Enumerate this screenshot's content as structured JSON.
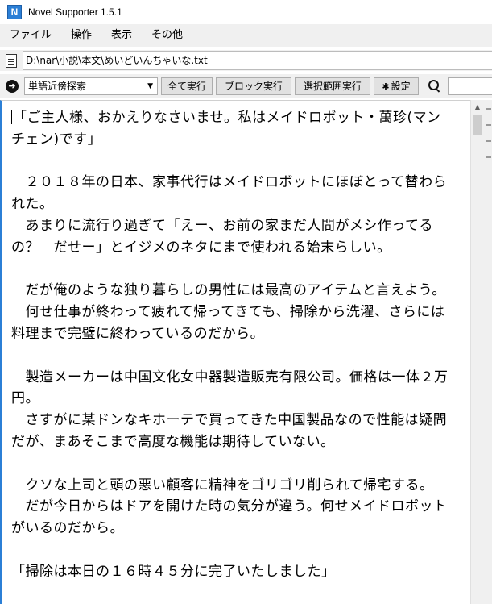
{
  "window": {
    "app_icon_letter": "N",
    "title": "Novel Supporter 1.5.1"
  },
  "menu": [
    "ファイル",
    "操作",
    "表示",
    "その他"
  ],
  "path": {
    "value": "D:\\nar\\小説\\本文\\めいどいんちゃいな.txt"
  },
  "toolbar": {
    "search_mode": "単語近傍探索",
    "btn_all": "全て実行",
    "btn_block": "ブロック実行",
    "btn_range": "選択範囲実行",
    "btn_settings": "設定",
    "search_value": ""
  },
  "icons": {
    "app": "app-logo-icon",
    "file": "document-icon",
    "nav": "arrow-right-circle-icon",
    "dropdown": "chevron-down-icon",
    "settings": "gear-icon",
    "search": "search-icon"
  },
  "colors": {
    "accent": "#2b7fd6",
    "chrome": "#f0f0f0"
  },
  "editor": {
    "text": "「ご主人様、おかえりなさいませ。私はメイドロボット・萬珍(マン\nチェン)です」\n\n　２０１８年の日本、家事代行はメイドロボットにほぼとって替わら\nれた。\n　あまりに流行り過ぎて「えー、お前の家まだ人間がメシ作ってる\nの？　だせー」とイジメのネタにまで使われる始末らしい。\n\n　だが俺のような独り暮らしの男性には最高のアイテムと言えよう。\n　何せ仕事が終わって疲れて帰ってきても、掃除から洗濯、さらには\n料理まで完璧に終わっているのだから。\n\n　製造メーカーは中国文化女中器製造販売有限公司。価格は一体２万\n円。\n　さすがに某ドンなキホーテで買ってきた中国製品なので性能は疑問\nだが、まあそこまで高度な機能は期待していない。\n\n　クソな上司と頭の悪い顧客に精神をゴリゴリ削られて帰宅する。\n　だが今日からはドアを開けた時の気分が違う。何せメイドロボット\nがいるのだから。\n\n「掃除は本日の１６時４５分に完了いたしました」"
  }
}
